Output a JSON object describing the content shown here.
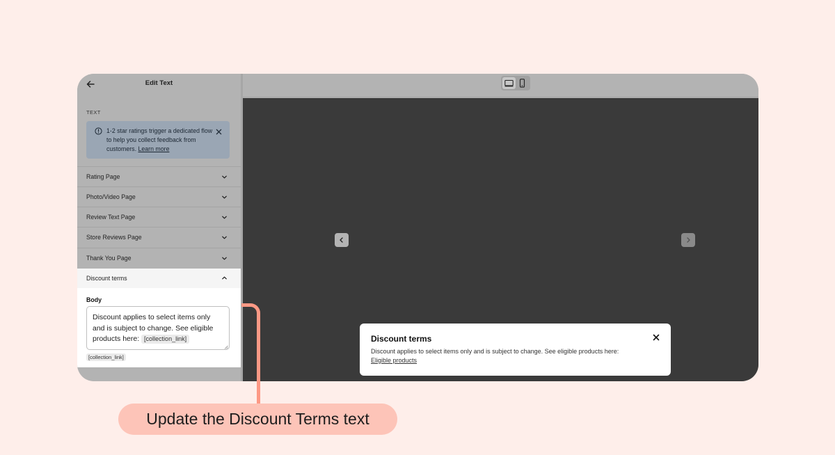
{
  "sidebar": {
    "title": "Edit Text",
    "section_label": "TEXT",
    "banner": {
      "text": "1-2 star ratings trigger a dedicated flow to help you collect feedback from customers.",
      "link": "Learn more"
    },
    "items": [
      {
        "label": "Rating Page"
      },
      {
        "label": "Photo/Video Page"
      },
      {
        "label": "Review Text Page"
      },
      {
        "label": "Store Reviews Page"
      },
      {
        "label": "Thank You Page"
      }
    ],
    "open_item": {
      "label": "Discount terms",
      "field_label": "Body",
      "field_value": "Discount applies to select items only and is subject to change. See eligible products here:",
      "field_token": "[collection_link]",
      "variable_chip": "[collection_link]"
    }
  },
  "modal": {
    "title": "Discount terms",
    "body": "Discount applies to select items only and is subject to change. See eligible products here:",
    "link": "Eligible products"
  },
  "callout": {
    "text": "Update the Discount Terms text"
  },
  "colors": {
    "page_bg": "#feeeea",
    "overlay_gray": "#b3b3b3",
    "preview_dark": "#3a3a3a",
    "banner_blue": "#9aa6b4",
    "callout_bg": "#fdc4b8",
    "connector": "#fd9985"
  }
}
